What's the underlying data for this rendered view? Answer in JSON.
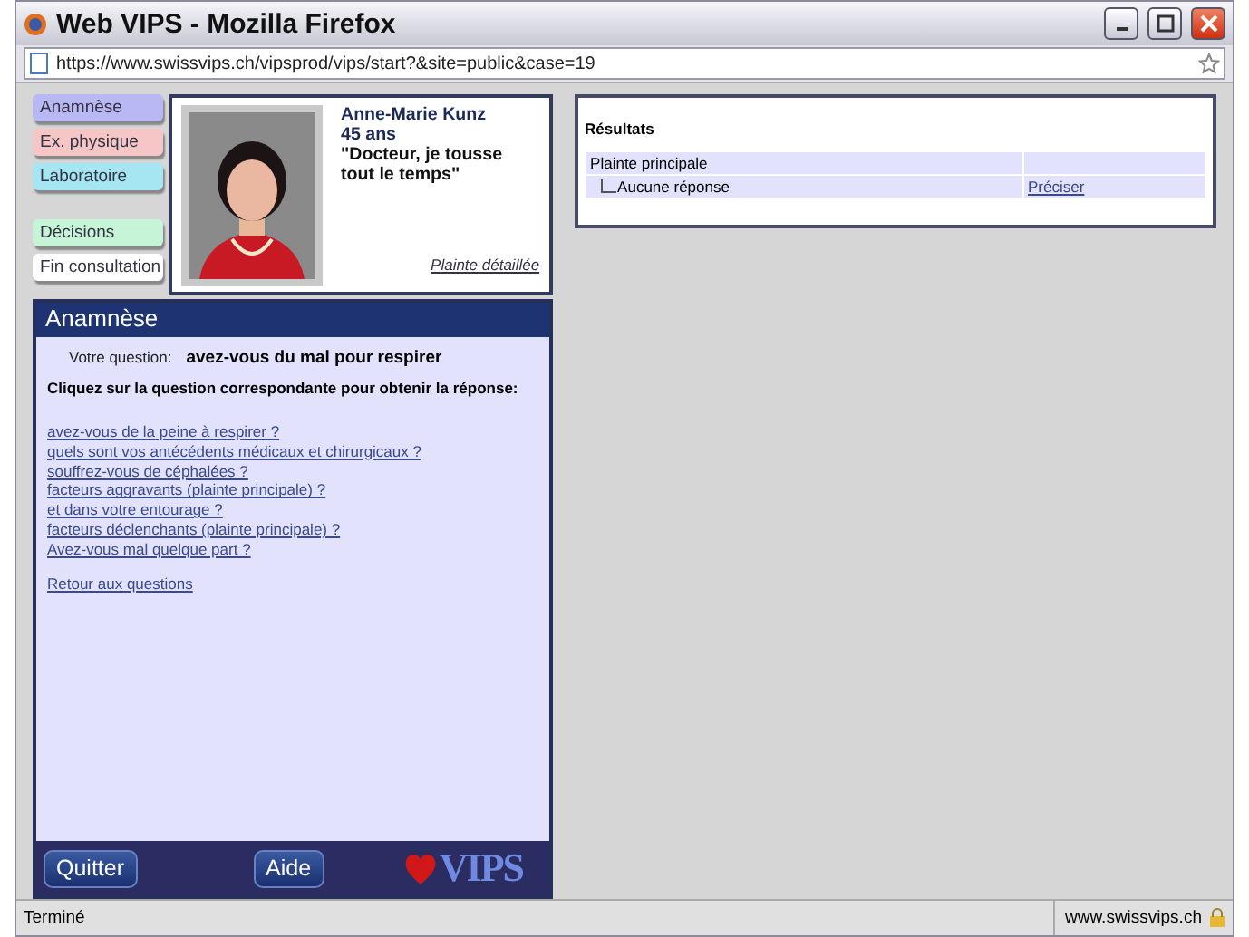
{
  "window": {
    "title": "Web VIPS - Mozilla Firefox"
  },
  "address_bar": {
    "url": "https://www.swissvips.ch/vipsprod/vips/start?&site=public&case=19"
  },
  "nav": [
    {
      "label": "Anamnèse",
      "color": "#b8b8f4"
    },
    {
      "label": "Ex. physique",
      "color": "#f6c6c6"
    },
    {
      "label": "Laboratoire",
      "color": "#a6e6f2"
    },
    {
      "label": "Décisions",
      "color": "#c6f4d6"
    },
    {
      "label": "Fin consultation",
      "color": "#ffffff"
    }
  ],
  "patient": {
    "kind": "picture",
    "name": "Anne-Marie Kunz",
    "age": "45 ans",
    "complaint": "\"Docteur, je tousse tout le temps\"",
    "link": "Plainte détaillée"
  },
  "anamnese": {
    "title": "Anamnèse",
    "question_label": "Votre question:",
    "question": "avez-vous du mal pour respirer",
    "instruction": "Cliquez sur la question correspondante pour obtenir la réponse:",
    "questions": [
      "avez-vous de la peine à respirer ?",
      "quels sont vos antécédents médicaux et chirurgicaux ?",
      "souffrez-vous de céphalées ?",
      "facteurs aggravants (plainte principale) ?",
      "et dans votre entourage ?",
      "facteurs déclenchants (plainte principale) ?",
      "Avez-vous mal quelque part ?"
    ],
    "back_link": "Retour aux questions"
  },
  "footer": {
    "buttons": [
      "Quitter",
      "Aide"
    ],
    "logo": "VIPS"
  },
  "results": {
    "title": "Résultats",
    "rows": [
      {
        "label": "Plainte principale"
      },
      {
        "label": "Aucune réponse",
        "link": "Préciser"
      }
    ]
  },
  "status_bar": {
    "text": "Terminé",
    "domain": "www.swissvips.ch"
  }
}
